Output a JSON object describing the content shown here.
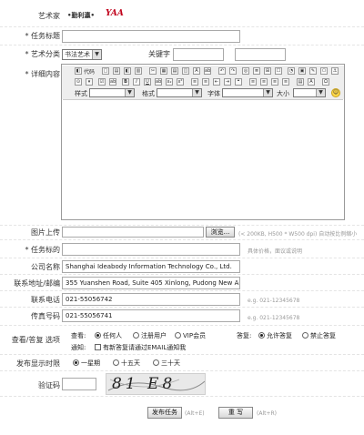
{
  "artist": {
    "label": "艺术家",
    "name": "•勤利瀛•",
    "logo": "YAA"
  },
  "title_field": {
    "label": "* 任务标题",
    "value": ""
  },
  "category": {
    "label": "* 艺术分类",
    "selected": "书法艺术",
    "keyword_label": "关键字"
  },
  "detail": {
    "label": "* 详细内容",
    "toolbar_row1": [
      "源",
      "代码",
      "□",
      "▤",
      "◧",
      "▥",
      "✂",
      "▦",
      "▤",
      "◫",
      "A",
      "ab",
      "↶",
      "↷",
      "◎",
      "≣",
      "⌕",
      "⊞",
      "☐",
      "◔",
      "▣",
      "✎",
      "⎔",
      "⊡",
      "◈",
      "✚",
      "⚓"
    ],
    "toolbar_row2": [
      "⊙",
      "▾",
      "☑",
      "ab",
      "B",
      "I",
      "U",
      "ab",
      "x₂",
      "x²",
      "Tx",
      "≡",
      "≡",
      "⇤",
      "⇥",
      "❝",
      "≡",
      "≡",
      "≡",
      "≡",
      "▤",
      "A",
      "A",
      "Ω"
    ],
    "style_label": "样式",
    "format_label": "格式",
    "font_label": "字体",
    "size_label": "大小"
  },
  "upload": {
    "label": "图片上传",
    "browse_label": "浏览...",
    "hint": "(< 200KB, H500 * W500 dpi) 自动按比例缩小"
  },
  "target": {
    "label": "* 任务标的",
    "hint": "具体价格，面议或说明"
  },
  "company": {
    "label": "公司名称",
    "value": "Shanghai Ideabody Information Technology Co., Ltd."
  },
  "address": {
    "label": "联系地址/邮编",
    "value": "355 Yuanshen Road, Suite 405 Xinlong, Pudong New Area, Shan"
  },
  "phone": {
    "label": "联系电话",
    "value": "021-55056742",
    "hint": "e.g. 021-12345678"
  },
  "fax": {
    "label": "传真号码",
    "value": "021-55056741",
    "hint": "e.g. 021-12345678"
  },
  "view": {
    "label": "查看/答复 选项",
    "view_label": "查看:",
    "view_options": [
      "任何人",
      "注册用户",
      "VIP会员"
    ],
    "reply_label": "答复:",
    "reply_options": [
      "允许答复",
      "禁止答复"
    ],
    "notify_label": "通知:",
    "notify_text": "有新答复请通过EMAIL通知我"
  },
  "duration": {
    "label": "发布显示时限",
    "options": [
      "一星期",
      "十五天",
      "三十天"
    ]
  },
  "captcha": {
    "label": "验证码",
    "image_text": "81 E8"
  },
  "actions": {
    "publish_label": "发布任务",
    "publish_hint": "(Alt+E)",
    "reset_label": "重 写",
    "reset_hint": "(Alt+R)"
  },
  "colors": {
    "logo": "#c0001a",
    "border": "#a9a9a9",
    "toolbar": "#eeeeee"
  }
}
